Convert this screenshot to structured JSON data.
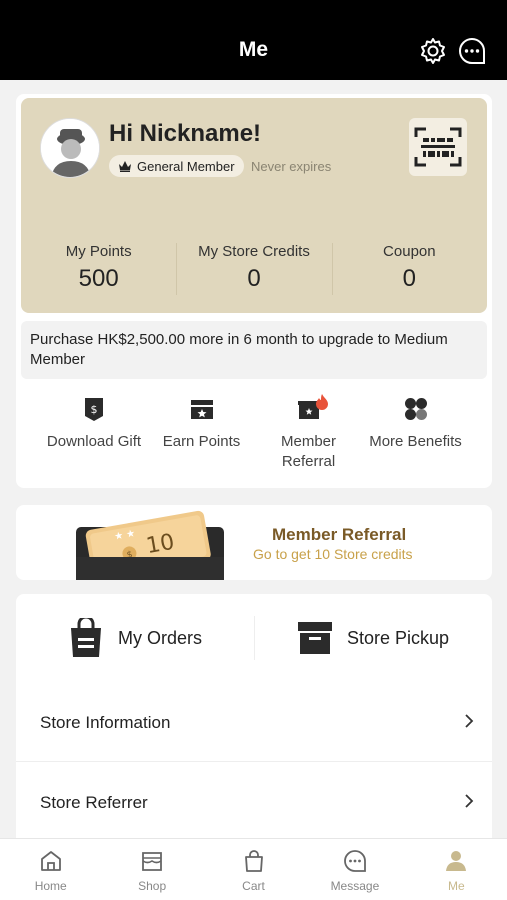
{
  "header": {
    "title": "Me",
    "settings_icon": "gear-icon",
    "message_icon": "chat-bubble-icon"
  },
  "profile": {
    "greeting": "Hi Nickname!",
    "level": "General Member",
    "expiry": "Never expires",
    "avatar_icon": "avatar-placeholder-icon",
    "qr_icon": "member-qr-code-icon"
  },
  "stats": [
    {
      "label": "My Points",
      "value": "500"
    },
    {
      "label": "My Store Credits",
      "value": "0"
    },
    {
      "label": "Coupon",
      "value": "0"
    }
  ],
  "upgrade_text": "Purchase HK$2,500.00 more in 6 month to upgrade to Medium Member",
  "quick_actions": [
    {
      "label": "Download Gift",
      "icon": "gift-download-icon"
    },
    {
      "label": "Earn Points",
      "icon": "earn-points-icon"
    },
    {
      "label": "Member Referral",
      "icon": "referral-icon"
    },
    {
      "label": "More Benefits",
      "icon": "benefits-icon"
    }
  ],
  "referral_banner": {
    "title": "Member Referral",
    "subtitle": "Go to get 10 Store credits",
    "ticket_value": "10"
  },
  "orders": [
    {
      "label": "My Orders",
      "icon": "shopping-bag-icon"
    },
    {
      "label": "Store Pickup",
      "icon": "store-box-icon"
    }
  ],
  "menu": [
    {
      "label": "Store Information"
    },
    {
      "label": "Store Referrer"
    }
  ],
  "tabs": [
    {
      "label": "Home",
      "icon": "home-icon"
    },
    {
      "label": "Shop",
      "icon": "shop-icon"
    },
    {
      "label": "Cart",
      "icon": "cart-icon"
    },
    {
      "label": "Message",
      "icon": "message-icon"
    },
    {
      "label": "Me",
      "icon": "user-icon",
      "active": true
    }
  ],
  "colors": {
    "accent": "#c8b98e",
    "card_bg": "#e0d7bd",
    "referral_title": "#7a5a27",
    "referral_sub": "#c8a14a"
  }
}
